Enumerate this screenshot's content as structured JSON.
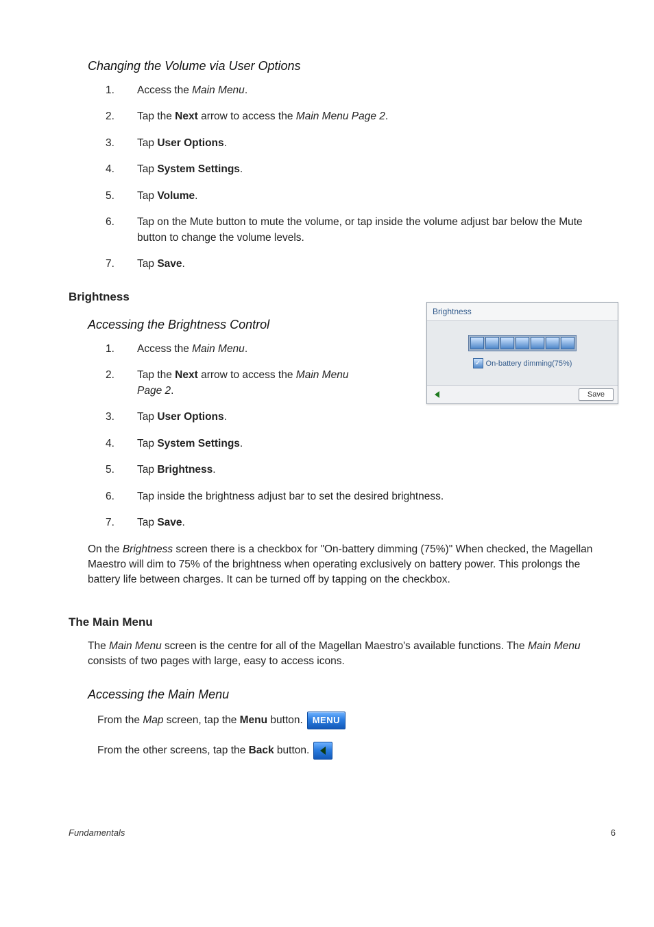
{
  "section1": {
    "heading": "Changing the Volume via User Options",
    "steps": [
      {
        "pre": "Access the ",
        "mid_italic": "Main Menu",
        "post": "."
      },
      {
        "pre": "Tap the ",
        "bold1": "Next",
        "post1": " arrow to access the ",
        "mid_italic": "Main Menu Page 2",
        "post": "."
      },
      {
        "pre": "Tap ",
        "bold1": "User Options",
        "post": "."
      },
      {
        "pre": "Tap ",
        "bold1": "System Settings",
        "post": "."
      },
      {
        "pre": "Tap ",
        "bold1": "Volume",
        "post": "."
      },
      {
        "text": "Tap on the Mute button to mute the volume, or tap inside the volume adjust bar below the Mute button to change the volume levels."
      },
      {
        "pre": "Tap ",
        "bold1": "Save",
        "post": "."
      }
    ]
  },
  "brightness_heading": "Brightness",
  "section2": {
    "heading": "Accessing the Brightness Control",
    "steps_narrow": [
      {
        "pre": "Access the ",
        "mid_italic": "Main Menu",
        "post": "."
      },
      {
        "pre": "Tap the ",
        "bold1": "Next",
        "post1": " arrow to access the ",
        "mid_italic": "Main Menu Page 2",
        "post": "."
      },
      {
        "pre": "Tap ",
        "bold1": "User Options",
        "post": "."
      },
      {
        "pre": "Tap ",
        "bold1": "System Settings",
        "post": "."
      },
      {
        "pre": "Tap ",
        "bold1": "Brightness",
        "post": "."
      }
    ],
    "steps_rest": [
      {
        "text": "Tap inside the brightness adjust bar to set the desired brightness."
      },
      {
        "pre": "Tap ",
        "bold1": "Save",
        "post": "."
      }
    ],
    "after_para_pre": "On the ",
    "after_para_italic": "Brightness",
    "after_para_post": " screen there is a checkbox for \"On-battery dimming (75%)\"  When checked, the Magellan Maestro will dim to 75% of the brightness when operating exclusively on battery power.  This prolongs the battery life between charges.  It can be turned off by tapping on the checkbox."
  },
  "main_menu": {
    "heading": "The Main Menu",
    "para_pre": "The ",
    "para_i1": "Main Menu",
    "para_mid": " screen is the centre for all of the Magellan Maestro's available functions.  The ",
    "para_i2": "Main Menu",
    "para_post": " consists of two pages with large, easy to access icons.",
    "sub_heading": "Accessing the Main Menu",
    "row1_pre": "From the ",
    "row1_i": "Map",
    "row1_mid": " screen, tap the ",
    "row1_b": "Menu",
    "row1_post": " button.",
    "menu_chip_label": "MENU",
    "row2_pre": "From the other screens, tap the ",
    "row2_b": "Back",
    "row2_post": " button."
  },
  "shot": {
    "title": "Brightness",
    "checkbox_label": "On-battery dimming(75%)",
    "save_label": "Save"
  },
  "footer": {
    "left": "Fundamentals",
    "right": "6"
  }
}
